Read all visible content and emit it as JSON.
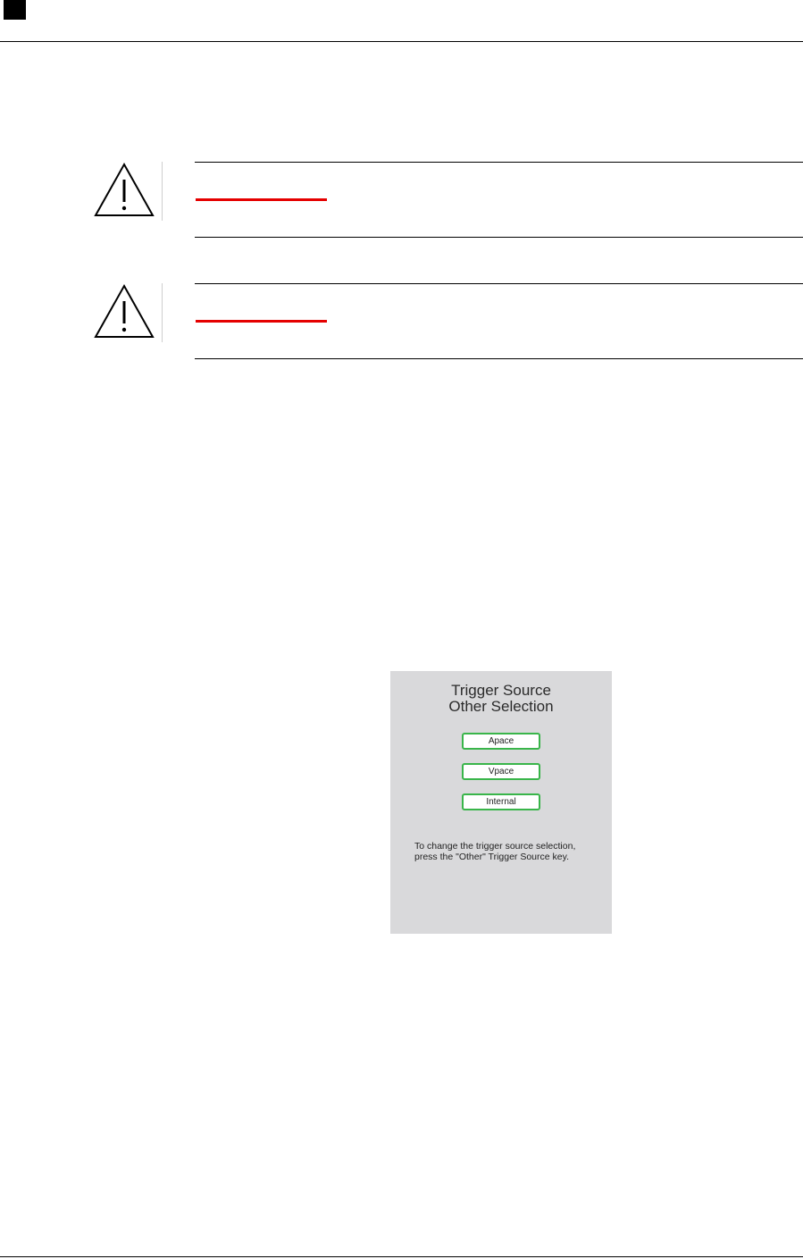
{
  "device_screen": {
    "title_line1": "Trigger Source",
    "title_line2": "Other Selection",
    "buttons": [
      {
        "label": "Apace"
      },
      {
        "label": "Vpace"
      },
      {
        "label": "Internal"
      }
    ],
    "hint_line1": "To change the trigger source selection,",
    "hint_line2": "press the \"Other\" Trigger Source key.",
    "button_border_color": "#39b54a",
    "background_color": "#d9d9db"
  },
  "warnings": [
    {
      "icon": "warning-triangle-icon",
      "accent_color": "#e50000"
    },
    {
      "icon": "warning-triangle-icon",
      "accent_color": "#e50000"
    }
  ]
}
